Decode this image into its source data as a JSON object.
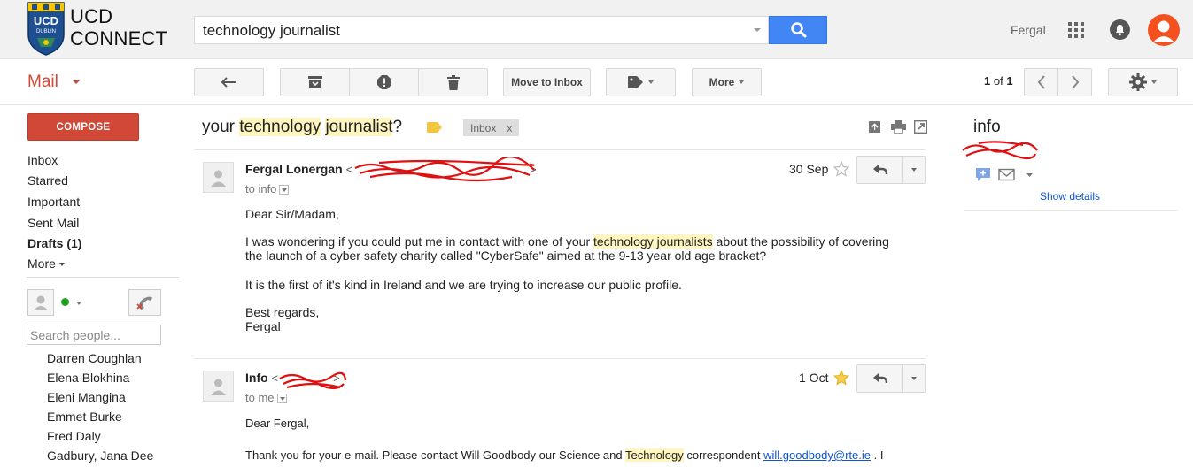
{
  "brand": {
    "logo_text_line1": "UCD",
    "logo_text_line2": "CONNECT",
    "crest_text": "UCD",
    "crest_sub": "DUBLIN"
  },
  "search": {
    "query": "technology journalist"
  },
  "header": {
    "user_name": "Fergal",
    "avatar_color": "#f4511e",
    "search_button_color": "#4285f4"
  },
  "app": {
    "mail_label": "Mail",
    "accent": "#d14836"
  },
  "toolbar": {
    "move_to_inbox": "Move to Inbox",
    "more": "More",
    "pager_current": "1",
    "pager_of": "of",
    "pager_total": "1"
  },
  "nav": {
    "compose": "COMPOSE",
    "items": [
      "Inbox",
      "Starred",
      "Important",
      "Sent Mail",
      "Drafts (1)",
      "More"
    ]
  },
  "chat": {
    "search_placeholder": "Search people...",
    "contacts": [
      "Darren Coughlan",
      "Elena Blokhina",
      "Eleni Mangina",
      "Emmet Burke",
      "Fred Daly",
      "Gadbury, Jana Dee"
    ]
  },
  "conversation": {
    "subject_pre": "your ",
    "subject_hl1": "technology",
    "subject_sp": " ",
    "subject_hl2": "journalist",
    "subject_post": "?",
    "label_chip": "Inbox",
    "label_chip_close": "x"
  },
  "messages": [
    {
      "sender": "Fergal Lonergan",
      "email_open": "<",
      "email_close": ">",
      "to": "to info",
      "date": "30 Sep",
      "starred": false,
      "greeting": "Dear Sir/Madam,",
      "p1_a": "I was wondering if you could put me in contact with one of your ",
      "p1_hl": "technology journalists",
      "p1_b": " about the possibility of covering",
      "p1_line2": "the launch of a cyber safety charity called \"CyberSafe\" aimed at the 9-13 year old age bracket?",
      "p2": "It is the first of it's kind in Ireland and we are trying to increase our public profile.",
      "signoff": "Best regards,",
      "signature": "Fergal"
    },
    {
      "sender": "Info",
      "email_open": "<",
      "email_close": ">",
      "to": "to me",
      "date": "1 Oct",
      "starred": true,
      "greeting": "Dear Fergal,",
      "p1_a": "Thank you for your e-mail.  Please contact Will Goodbody our Science and ",
      "p1_hl": "Technology",
      "p1_b": " correspondent ",
      "link": "will.goodbody@rte.ie",
      "p1_c": " .  I"
    }
  ],
  "right_panel": {
    "name": "info",
    "show_details": "Show details"
  }
}
